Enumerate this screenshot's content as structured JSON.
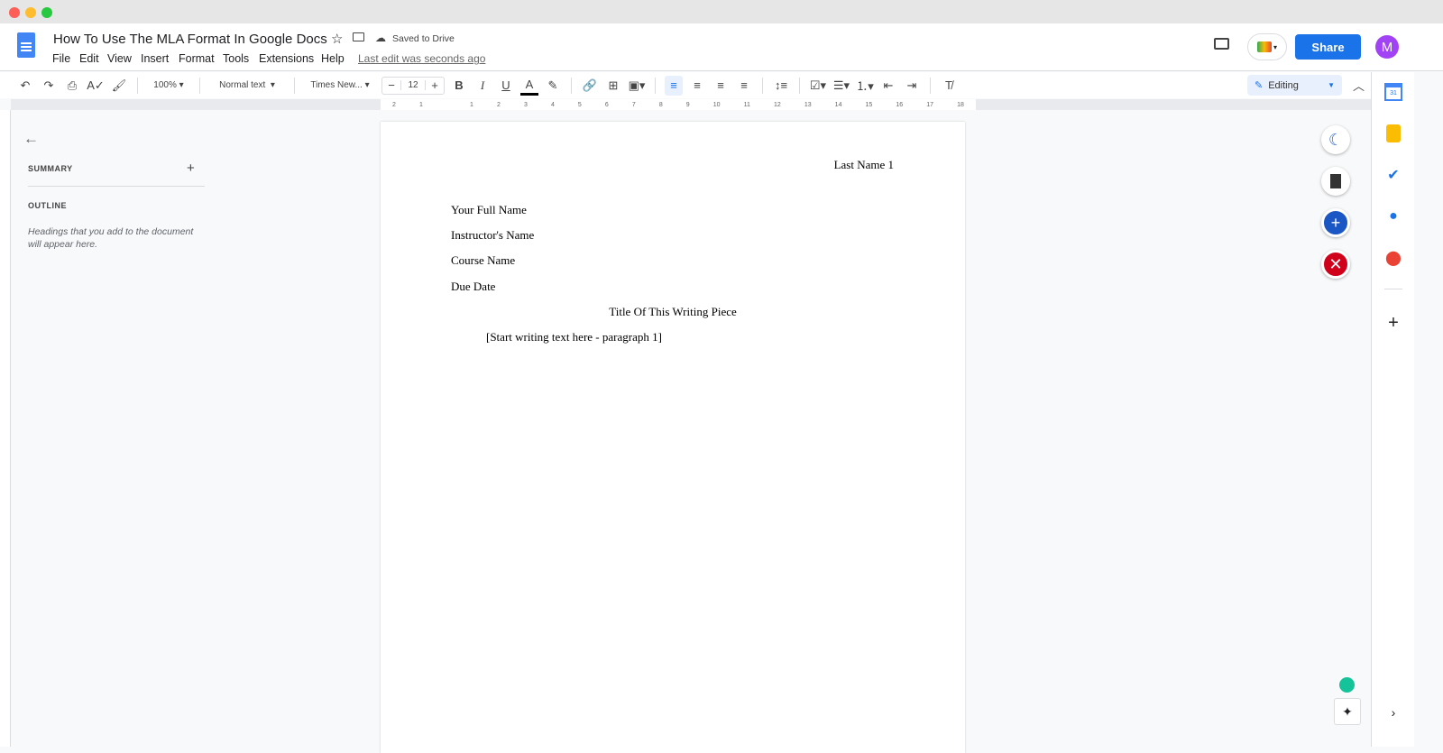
{
  "doc": {
    "title": "How To Use The MLA Format In Google Docs",
    "saved": "Saved to Drive",
    "last_edit": "Last edit was seconds ago"
  },
  "menu": [
    "File",
    "Edit",
    "View",
    "Insert",
    "Format",
    "Tools",
    "Extensions",
    "Help"
  ],
  "header": {
    "share": "Share",
    "avatar": "M"
  },
  "toolbar": {
    "zoom": "100%",
    "style": "Normal text",
    "font": "Times New...",
    "size": "12",
    "mode": "Editing"
  },
  "ruler": [
    "2",
    "1",
    "",
    "1",
    "2",
    "3",
    "4",
    "5",
    "6",
    "7",
    "8",
    "9",
    "10",
    "11",
    "12",
    "13",
    "14",
    "15",
    "16",
    "17",
    "18"
  ],
  "sidebar": {
    "summary": "SUMMARY",
    "outline": "OUTLINE",
    "hint": "Headings that you add to the document will appear here."
  },
  "page": {
    "header": "Last Name 1",
    "lines": [
      "Your Full Name",
      "Instructor's Name",
      "Course Name",
      "Due Date"
    ],
    "title": "Title Of This Writing Piece",
    "para": "[Start writing text here - paragraph 1]"
  },
  "colors": {
    "accent": "#1a73e8",
    "avatar": "#a142f4"
  }
}
